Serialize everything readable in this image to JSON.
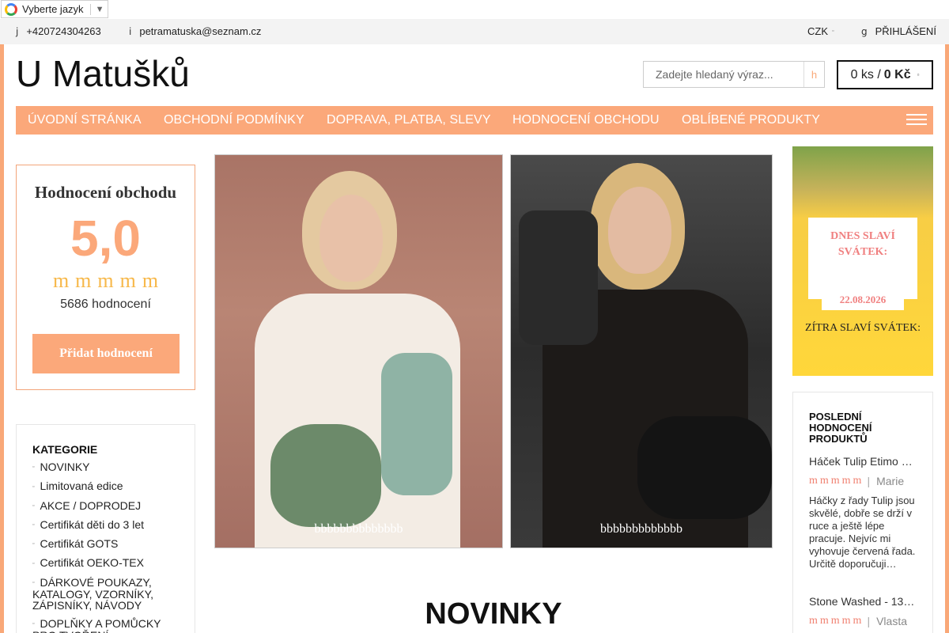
{
  "translate": {
    "label": "Vyberte jazyk",
    "arrow": "▼"
  },
  "topbar": {
    "phone_icon": "j",
    "phone": "+420724304263",
    "email_icon": "i",
    "email": "petramatuska@seznam.cz",
    "currency": "CZK",
    "currency_icon": "▫",
    "login_icon": "g",
    "login": "PŘIHLÁŠENÍ"
  },
  "header": {
    "logo": "U Matušků",
    "search_placeholder": "Zadejte hledaný výraz...",
    "search_icon": "h",
    "cart_count": "0 ks /",
    "cart_price": "0 Kč",
    "cart_icon": "▫"
  },
  "nav": {
    "items": [
      "ÚVODNÍ STRÁNKA",
      "OBCHODNÍ PODMÍNKY",
      "DOPRAVA, PLATBA, SLEVY",
      "HODNOCENÍ OBCHODU",
      "OBLÍBENÉ PRODUKTY"
    ]
  },
  "rating": {
    "title": "Hodnocení obchodu",
    "score": "5,0",
    "stars": "mmmmm",
    "count": "5686 hodnocení",
    "add_button": "Přidat hodnocení"
  },
  "categories": {
    "title": "KATEGORIE",
    "items": [
      "NOVINKY",
      "Limitovaná edice",
      "AKCE / DOPRODEJ",
      "Certifikát děti do 3 let",
      "Certifikát GOTS",
      "Certifikát OEKO-TEX",
      "DÁRKOVÉ POUKAZY, KATALOGY, VZORNÍKY, ZÁPISNÍKY, NÁVODY",
      "DOPLŇKY A POMŮCKY PRO TVOŘENÍ"
    ]
  },
  "banners": {
    "dots1": "bbbbbbbbbbbbbb",
    "dots2": "bbbbbbbbbbbbb"
  },
  "holiday": {
    "today_label": "DNES SLAVÍ SVÁTEK:",
    "date": "22.08.2026",
    "tomorrow_label": "ZÍTRA SLAVÍ SVÁTEK:"
  },
  "reviews": {
    "title": "POSLEDNÍ HODNOCENÍ PRODUKTŮ",
    "items": [
      {
        "product": "Háček Tulip Etimo Red",
        "stars": "mmmmm",
        "sep": "|",
        "author": "Marie",
        "text": "Háčky z řady Tulip jsou skvělé, dobře se drží v ruce a ještě lépe pracuje. Nejvíc mi vyhovuje červená řada. Určitě doporučuji…"
      },
      {
        "product": "Stone Washed - 13…",
        "stars": "mmmmm",
        "sep": "|",
        "author": "Vlasta"
      }
    ]
  },
  "main": {
    "heading": "NOVINKY"
  },
  "colors": {
    "accent": "#fba87a",
    "star": "#f7b84a",
    "holiday_text": "#f08080"
  }
}
